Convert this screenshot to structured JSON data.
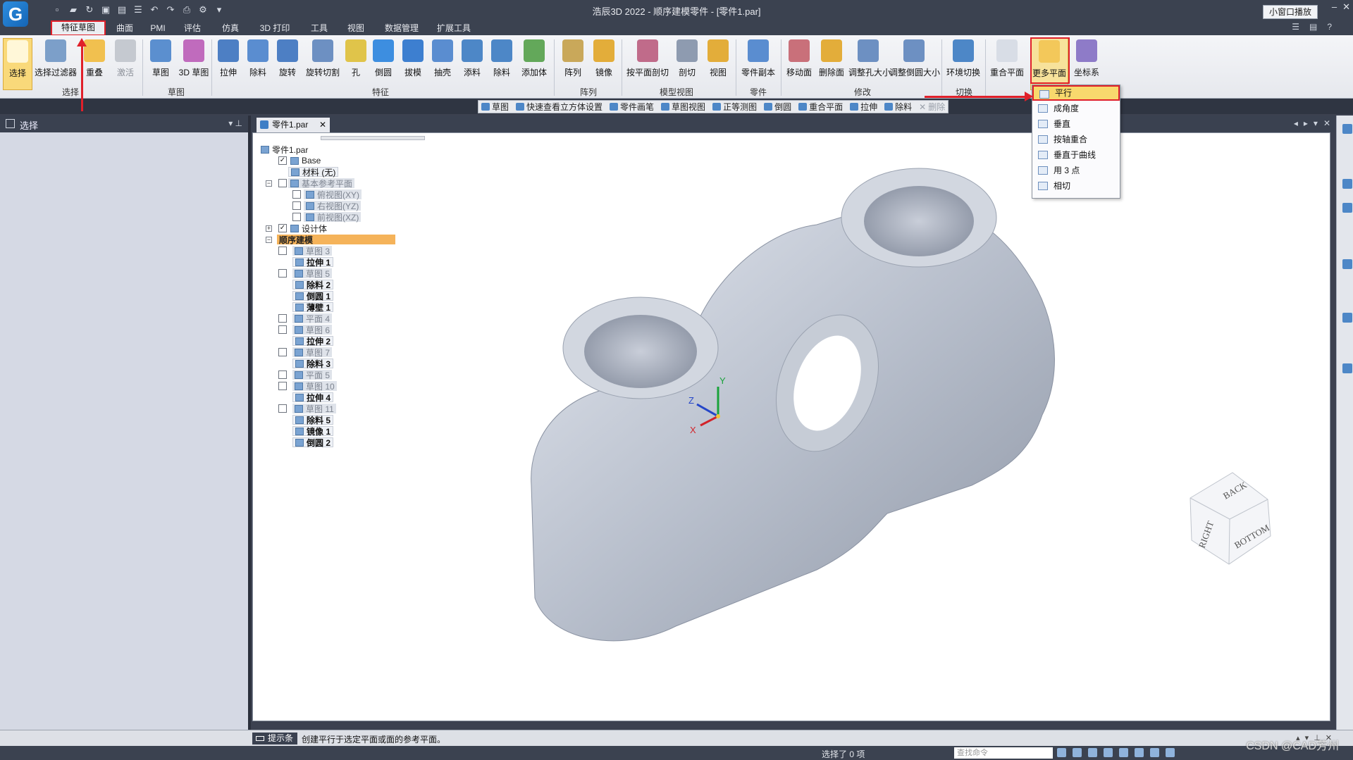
{
  "window": {
    "title": "浩辰3D 2022 - 顺序建模零件 - [零件1.par]",
    "small_window_label": "小窗口播放",
    "logo_letter": "G"
  },
  "menu_tabs": [
    "特征草图",
    "曲面",
    "PMI",
    "评估",
    "仿真",
    "3D 打印",
    "工具",
    "视图",
    "数据管理",
    "扩展工具"
  ],
  "active_tab": "特征草图",
  "ribbon": {
    "groups": [
      "选择",
      "草图",
      "特征",
      "阵列",
      "模型视图",
      "零件",
      "修改",
      "切换"
    ],
    "buttons": {
      "select": "选择",
      "select_filter": "选择过滤器",
      "overlap": "重叠",
      "activate": "激活",
      "sketch": "草图",
      "sketch3d": "3D 草图",
      "extrude": "拉伸",
      "cut": "除料",
      "revolve": "旋转",
      "revolve_cut": "旋转切割",
      "hole": "孔",
      "round": "倒圆",
      "draft": "拔模",
      "thin": "抽壳",
      "add": "添料",
      "remove": "除料",
      "add_body": "添加体",
      "pattern": "阵列",
      "mirror": "镜像",
      "plane_cut": "按平面剖切",
      "section": "剖切",
      "view": "视图",
      "part_copy": "零件副本",
      "move_face": "移动面",
      "delete_face": "删除面",
      "resize_hole": "调整孔大小",
      "resize_round": "调整倒圆大小",
      "env_switch": "环境切换",
      "coincident_plane": "重合平面",
      "more_planes": "更多平面",
      "coord_sys": "坐标系"
    }
  },
  "command_bar": [
    "草图",
    "快速查看立方体设置",
    "零件画笔",
    "草图视图",
    "正等测图",
    "倒圆",
    "重合平面",
    "拉伸",
    "除料",
    "删除"
  ],
  "more_planes_menu": [
    "平行",
    "成角度",
    "垂直",
    "按轴重合",
    "垂直于曲线",
    "用 3 点",
    "相切"
  ],
  "left_panel": {
    "title": "选择"
  },
  "document": {
    "tab": "零件1.par"
  },
  "tree": {
    "root": "零件1.par",
    "base": "Base",
    "material": "材料 (无)",
    "ref_planes": "基本参考平面",
    "planes": [
      "俯视图(XY)",
      "右视图(YZ)",
      "前视图(XZ)"
    ],
    "design_body": "设计体",
    "seq_modeling": "顺序建模",
    "items": [
      {
        "label": "草图 3",
        "kind": "sketch"
      },
      {
        "label": "拉伸 1",
        "kind": "feature"
      },
      {
        "label": "草图 5",
        "kind": "sketch"
      },
      {
        "label": "除料 2",
        "kind": "feature"
      },
      {
        "label": "倒圆 1",
        "kind": "feature"
      },
      {
        "label": "薄壁 1",
        "kind": "feature"
      },
      {
        "label": "平面 4",
        "kind": "plane"
      },
      {
        "label": "草图 6",
        "kind": "sketch"
      },
      {
        "label": "拉伸 2",
        "kind": "feature"
      },
      {
        "label": "草图 7",
        "kind": "sketch"
      },
      {
        "label": "除料 3",
        "kind": "feature"
      },
      {
        "label": "平面 5",
        "kind": "plane"
      },
      {
        "label": "草图 10",
        "kind": "sketch"
      },
      {
        "label": "拉伸 4",
        "kind": "feature"
      },
      {
        "label": "草图 11",
        "kind": "sketch"
      },
      {
        "label": "除料 5",
        "kind": "feature"
      },
      {
        "label": "镜像 1",
        "kind": "feature"
      },
      {
        "label": "倒圆 2",
        "kind": "feature"
      }
    ]
  },
  "triad": {
    "x": "X",
    "y": "Y",
    "z": "Z"
  },
  "view_cube": {
    "back": "BACK",
    "right": "RIGHT",
    "bottom": "BOTTOM"
  },
  "status": {
    "prompt_label": "提示条",
    "prompt_text": "创建平行于选定平面或面的参考平面。",
    "selected": "选择了 0 项",
    "search_placeholder": "查找命令"
  },
  "watermark": "CSDN @CAD芳州",
  "colors": {
    "accent_red": "#e0202a",
    "highlight": "#f8d96d",
    "tree_highlight": "#f5b35a",
    "chrome": "#3b4250"
  }
}
